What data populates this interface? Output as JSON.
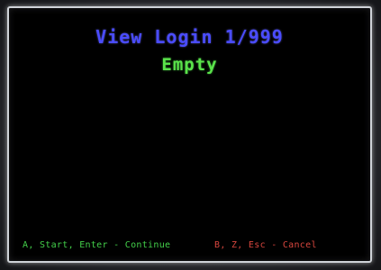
{
  "screen": {
    "title_prefix": "View Login",
    "title_counter": "1/999",
    "status": "Empty"
  },
  "footer": {
    "continue_hint": "A, Start, Enter - Continue",
    "cancel_hint": "B, Z, Esc - Cancel"
  },
  "colors": {
    "title": "#4a4cff",
    "status": "#5ae24a",
    "continue_hint": "#43d04a",
    "cancel_hint": "#d8463e",
    "background": "#000000"
  }
}
